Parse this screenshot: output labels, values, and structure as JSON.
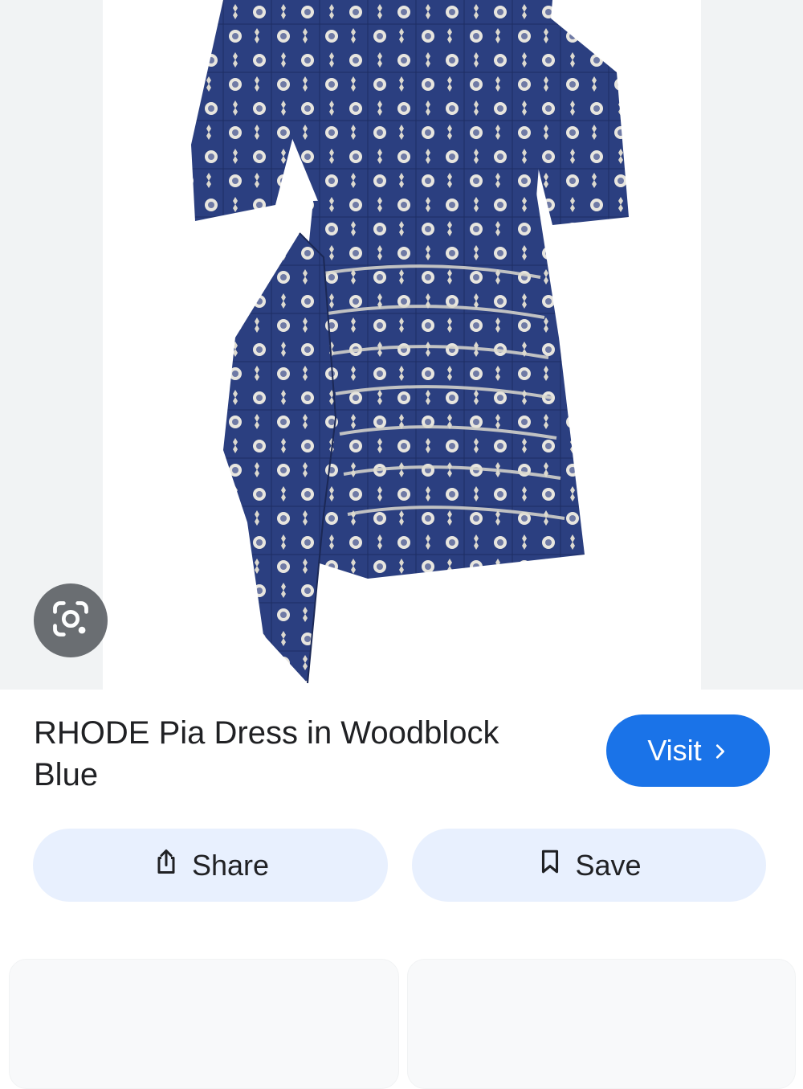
{
  "product": {
    "title": "RHODE Pia Dress in Woodblock Blue",
    "image_alt": "Blue woodblock print ruched mini dress"
  },
  "actions": {
    "visit_label": "Visit",
    "share_label": "Share",
    "save_label": "Save"
  },
  "colors": {
    "dress_blue": "#2b3f80",
    "accent": "#1a73e8",
    "button_tint": "#e8f0fe"
  },
  "icons": {
    "lens": "google-lens-icon",
    "visit": "chevron-right-icon",
    "share": "share-icon",
    "save": "bookmark-icon"
  }
}
